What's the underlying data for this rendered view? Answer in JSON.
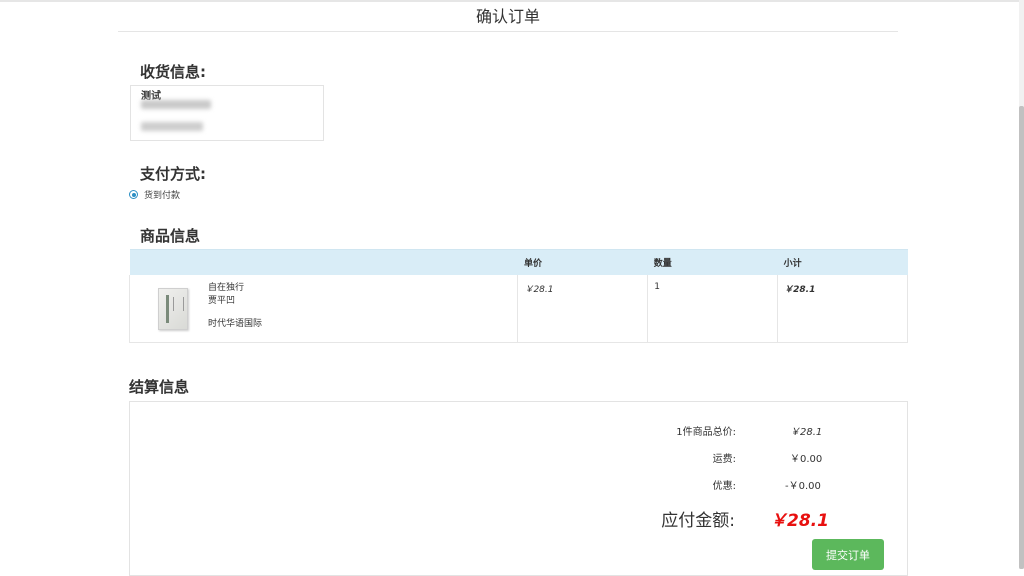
{
  "page": {
    "title": "确认订单"
  },
  "shipping": {
    "heading": "收货信息:",
    "name": "测试"
  },
  "payment": {
    "heading": "支付方式:",
    "option": "货到付款"
  },
  "goods": {
    "heading": "商品信息",
    "columns": {
      "product": "",
      "price": "单价",
      "qty": "数量",
      "subtotal": "小计"
    },
    "items": [
      {
        "title": "自在独行",
        "author": "贾平凹",
        "publisher": "时代华语国际",
        "price": "￥28.1",
        "qty": "1",
        "subtotal": "￥28.1"
      }
    ]
  },
  "settlement": {
    "heading": "结算信息",
    "items_total_label": "1件商品总价:",
    "items_total_value": "￥28.1",
    "shipping_label": "运费:",
    "shipping_value": "￥0.00",
    "discount_label": "优惠:",
    "discount_value": "-￥0.00",
    "payable_label": "应付金额:",
    "payable_value": "￥28.1",
    "submit_label": "提交订单"
  },
  "colors": {
    "accent_red": "#e8100f",
    "submit_green": "#5cb85c",
    "table_header": "#d9edf7",
    "radio_blue": "#2c8fc4"
  }
}
